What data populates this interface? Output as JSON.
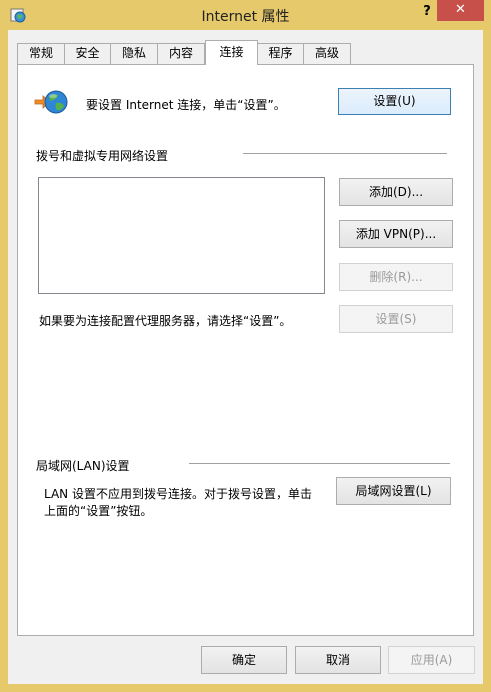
{
  "window": {
    "title": "Internet 属性",
    "help_label": "?",
    "close_label": "✕"
  },
  "tabs": [
    {
      "label": "常规"
    },
    {
      "label": "安全"
    },
    {
      "label": "隐私"
    },
    {
      "label": "内容"
    },
    {
      "label": "连接"
    },
    {
      "label": "程序"
    },
    {
      "label": "高级"
    }
  ],
  "active_tab": "连接",
  "setup": {
    "description": "要设置 Internet 连接，单击“设置”。",
    "button": "设置(U)",
    "icon": "globe-network-icon"
  },
  "dialup": {
    "heading": "拨号和虚拟专用网络设置",
    "add_button": "添加(D)...",
    "add_vpn_button": "添加 VPN(P)...",
    "delete_button": "删除(R)...",
    "settings_button": "设置(S)",
    "proxy_text": "如果要为连接配置代理服务器，请选择“设置”。"
  },
  "lan": {
    "heading": "局域网(LAN)设置",
    "line1": "LAN 设置不应用到拨号连接。对于拨号设置，单击",
    "line2": "上面的“设置”按钮。",
    "button": "局域网设置(L)"
  },
  "footer": {
    "ok": "确定",
    "cancel": "取消",
    "apply": "应用(A)"
  },
  "colors": {
    "frame": "#e6c96a",
    "close": "#c7504b",
    "accent_border": "#3c7fb1"
  }
}
